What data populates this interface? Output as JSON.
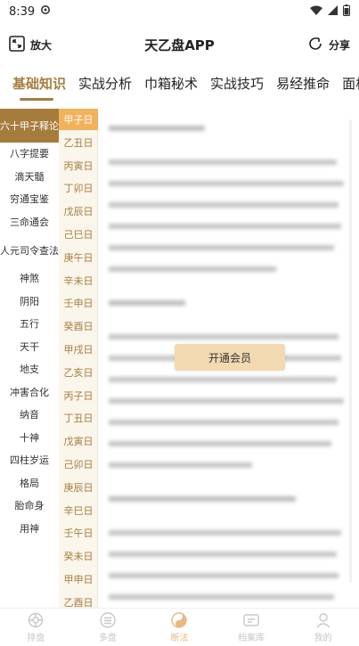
{
  "status": {
    "time": "8:39"
  },
  "header": {
    "title": "天乙盘APP",
    "zoom_label": "放大",
    "share_label": "分享"
  },
  "tabs": [
    {
      "label": "基础知识",
      "active": true
    },
    {
      "label": "实战分析"
    },
    {
      "label": "巾箱秘术"
    },
    {
      "label": "实战技巧"
    },
    {
      "label": "易经推命"
    },
    {
      "label": "面相解读"
    }
  ],
  "categories": [
    {
      "label": "六十甲子释论",
      "active": true
    },
    {
      "label": "八字提要"
    },
    {
      "label": "滴天髓"
    },
    {
      "label": "穷通宝鉴"
    },
    {
      "label": "三命通会"
    },
    {
      "label": "人元司令查法"
    },
    {
      "label": "神煞"
    },
    {
      "label": "阴阳"
    },
    {
      "label": "五行"
    },
    {
      "label": "天干"
    },
    {
      "label": "地支"
    },
    {
      "label": "冲害合化"
    },
    {
      "label": "纳音"
    },
    {
      "label": "十神"
    },
    {
      "label": "四柱岁运"
    },
    {
      "label": "格局"
    },
    {
      "label": "胎命身"
    },
    {
      "label": "用神"
    }
  ],
  "days": [
    {
      "label": "甲子日",
      "active": true
    },
    {
      "label": "乙丑日"
    },
    {
      "label": "丙寅日"
    },
    {
      "label": "丁卯日"
    },
    {
      "label": "戊辰日"
    },
    {
      "label": "己巳日"
    },
    {
      "label": "庚午日"
    },
    {
      "label": "辛未日"
    },
    {
      "label": "壬申日"
    },
    {
      "label": "癸酉日"
    },
    {
      "label": "甲戌日"
    },
    {
      "label": "乙亥日"
    },
    {
      "label": "丙子日"
    },
    {
      "label": "丁丑日"
    },
    {
      "label": "戊寅日"
    },
    {
      "label": "己卯日"
    },
    {
      "label": "庚辰日"
    },
    {
      "label": "辛巳日"
    },
    {
      "label": "壬午日"
    },
    {
      "label": "癸未日"
    },
    {
      "label": "甲申日"
    },
    {
      "label": "乙酉日"
    }
  ],
  "content": {
    "vip_button": "开通会员"
  },
  "bottom_nav": [
    {
      "label": "排盘",
      "icon": "chart-wheel-icon"
    },
    {
      "label": "多盘",
      "icon": "list-stack-icon"
    },
    {
      "label": "断法",
      "icon": "yin-yang-icon",
      "active": true
    },
    {
      "label": "档案库",
      "icon": "folder-icon"
    },
    {
      "label": "我的",
      "icon": "user-icon"
    }
  ],
  "colors": {
    "accent": "#a67c3d",
    "day_active": "#f2b25b",
    "vip": "#f2d9b1",
    "nav_active": "#e7b985"
  }
}
